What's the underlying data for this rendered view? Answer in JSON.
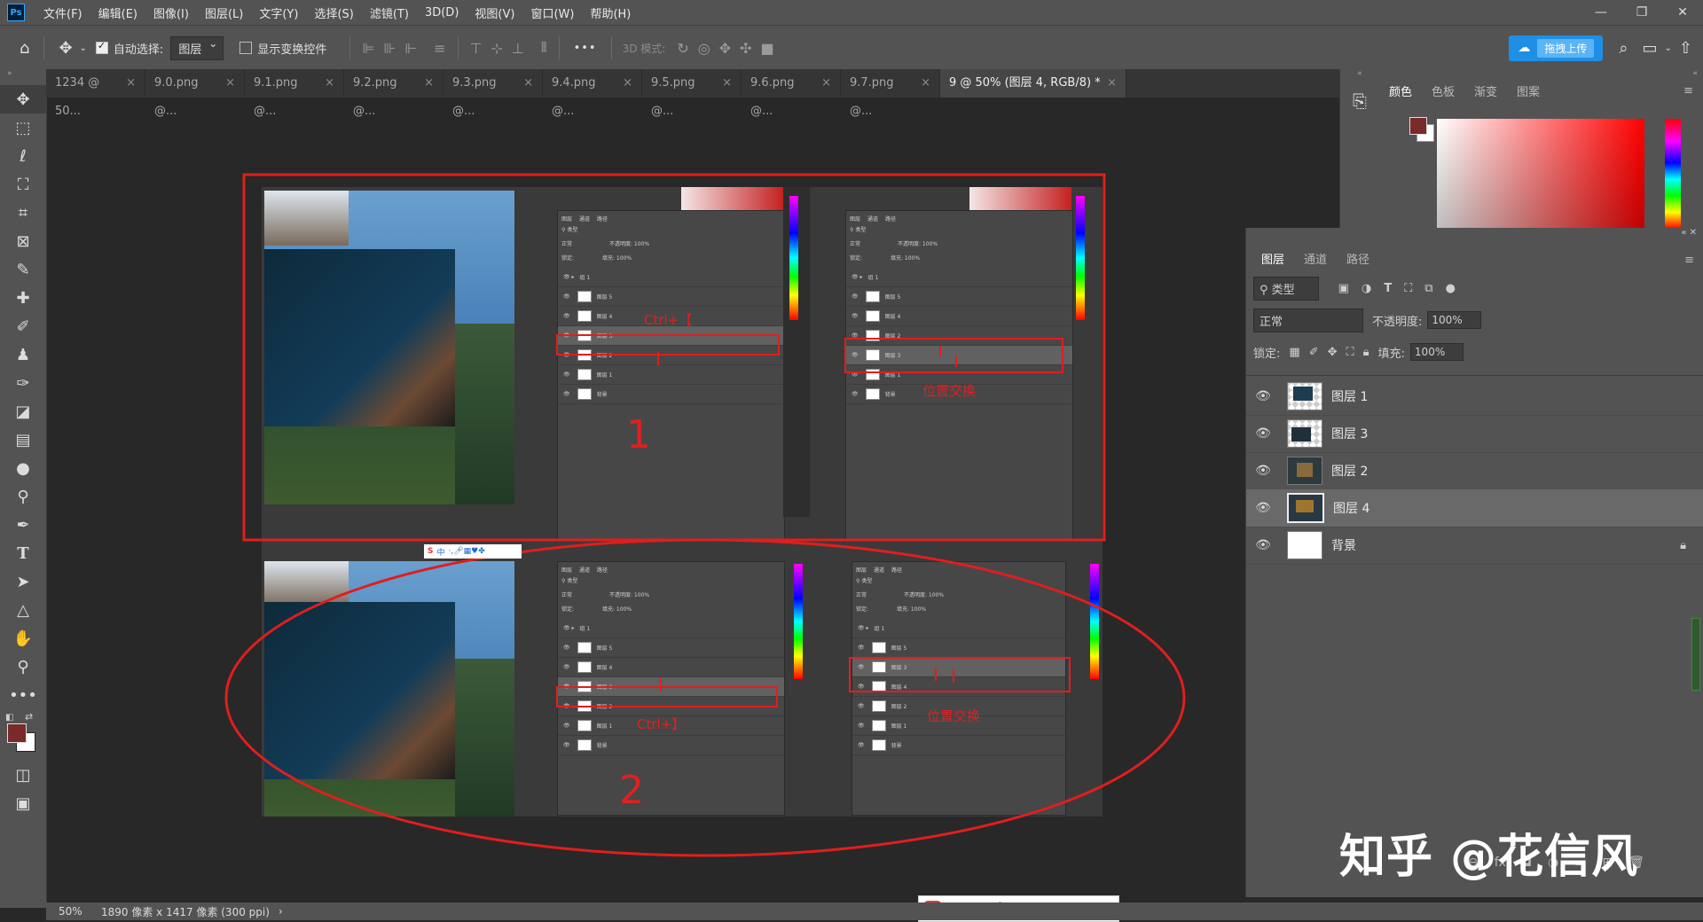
{
  "menu": {
    "logo": "Ps",
    "items": [
      "文件(F)",
      "编辑(E)",
      "图像(I)",
      "图层(L)",
      "文字(Y)",
      "选择(S)",
      "滤镜(T)",
      "3D(D)",
      "视图(V)",
      "窗口(W)",
      "帮助(H)"
    ]
  },
  "options": {
    "auto_select_label": "自动选择:",
    "auto_select_target": "图层",
    "show_transform_label": "显示变换控件",
    "more_label": "•••",
    "mode_3d_label": "3D 模式:",
    "upload_label": "拖拽上传"
  },
  "tabs": [
    {
      "label": "1234 @ 50..."
    },
    {
      "label": "9.0.png @..."
    },
    {
      "label": "9.1.png @..."
    },
    {
      "label": "9.2.png @..."
    },
    {
      "label": "9.3.png @..."
    },
    {
      "label": "9.4.png @..."
    },
    {
      "label": "9.5.png @..."
    },
    {
      "label": "9.6.png @..."
    },
    {
      "label": "9.7.png @..."
    },
    {
      "label": "9 @ 50% (图层 4, RGB/8) *"
    }
  ],
  "tab_close": "×",
  "color_panel": {
    "tabs": [
      "颜色",
      "色板",
      "渐变",
      "图案"
    ],
    "foreground": "#7a2a2a",
    "background": "#ffffff"
  },
  "layers_panel": {
    "tabs": [
      "图层",
      "通道",
      "路径"
    ],
    "filter_label": "类型",
    "blend_mode": "正常",
    "opacity_label": "不透明度:",
    "opacity_value": "100%",
    "lock_label": "锁定:",
    "fill_label": "填充:",
    "fill_value": "100%",
    "layers": [
      {
        "name": "图层 1",
        "selected": false,
        "locked": false
      },
      {
        "name": "图层 3",
        "selected": false,
        "locked": false
      },
      {
        "name": "图层 2",
        "selected": false,
        "locked": false
      },
      {
        "name": "图层 4",
        "selected": true,
        "locked": false
      },
      {
        "name": "背景",
        "selected": false,
        "locked": true
      }
    ]
  },
  "status": {
    "zoom": "50%",
    "doc_size": "1890 像素 x 1417 像素 (300 ppi)"
  },
  "canvas_annotations": {
    "ctrl_bracket_left": "Ctrl+【",
    "ctrl_bracket_right": "Ctrl+】",
    "swap_top": "位置交换",
    "swap_bottom": "位置交换",
    "num1": "1",
    "num2": "2"
  },
  "mini_panels": {
    "tabs": [
      "图层",
      "通道",
      "路径"
    ],
    "type_label": "类型",
    "normal_label": "正常",
    "opacity_label": "不透明度:",
    "lock_label": "锁定:",
    "fill_label": "填充:",
    "pct": "100%",
    "group": "组 1",
    "top_left_rows": [
      "图层 5",
      "图层 4",
      "图层 3",
      "图层 2",
      "图层 1",
      "背景"
    ],
    "top_right_rows": [
      "图层 5",
      "图层 4",
      "图层 2",
      "图层 3",
      "图层 1",
      "背景"
    ],
    "bottom_left_rows": [
      "图层 5",
      "图层 4",
      "图层 3",
      "图层 2",
      "图层 1",
      "背景"
    ],
    "bottom_right_rows": [
      "图层 5",
      "图层 3",
      "图层 4",
      "图层 2",
      "图层 1",
      "背景"
    ]
  },
  "ime": {
    "label": "中"
  },
  "watermark": "知乎 @花信风"
}
